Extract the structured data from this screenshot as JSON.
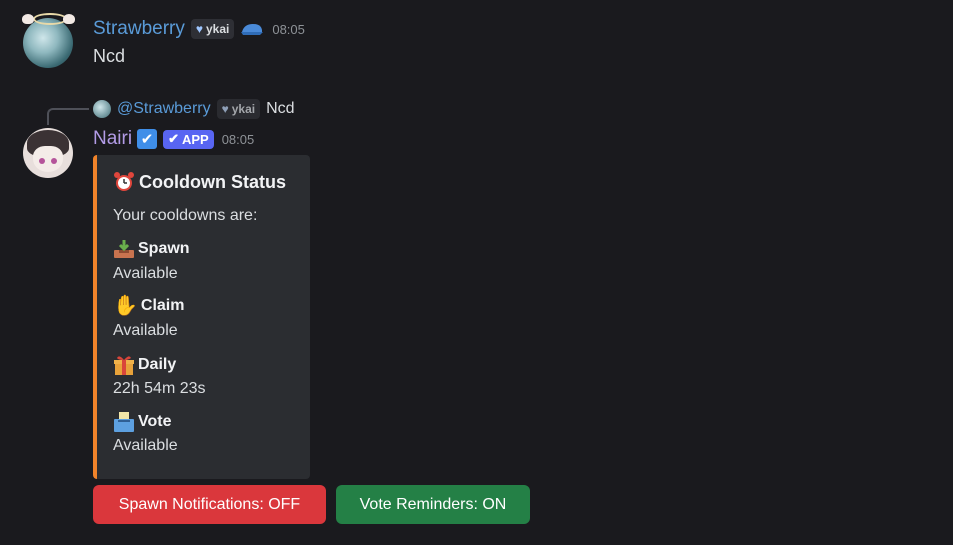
{
  "colors": {
    "strawberry_name": "#5a9bd8",
    "nairi_name": "#b29be6",
    "embed_accent": "#f0832a",
    "button_danger": "#da373c",
    "button_success": "#248046",
    "app_badge": "#5865f2"
  },
  "message1": {
    "username": "Strawberry",
    "tag": "ykai",
    "tag_icon": "heart-icon",
    "badge_icon": "blue-cap-icon",
    "timestamp": "08:05",
    "content": "Ncd"
  },
  "message2": {
    "reply": {
      "username": "@Strawberry",
      "tag": "ykai",
      "content": "Ncd"
    },
    "username": "Nairi",
    "verified_icon": "check-box-icon",
    "app_label": "APP",
    "timestamp": "08:05",
    "embed": {
      "title_icon": "alarm-clock-icon",
      "title": "Cooldown Status",
      "description": "Your cooldowns are:",
      "fields": [
        {
          "icon": "inbox-tray-icon",
          "name": "Spawn",
          "value": "Available"
        },
        {
          "icon": "raised-hand-icon",
          "name": "Claim",
          "value": "Available"
        },
        {
          "icon": "gift-icon",
          "name": "Daily",
          "value": "22h 54m 23s"
        },
        {
          "icon": "ballot-box-icon",
          "name": "Vote",
          "value": "Available"
        }
      ]
    },
    "buttons": {
      "spawn_notifications": "Spawn Notifications: OFF",
      "vote_reminders": "Vote Reminders: ON"
    }
  }
}
